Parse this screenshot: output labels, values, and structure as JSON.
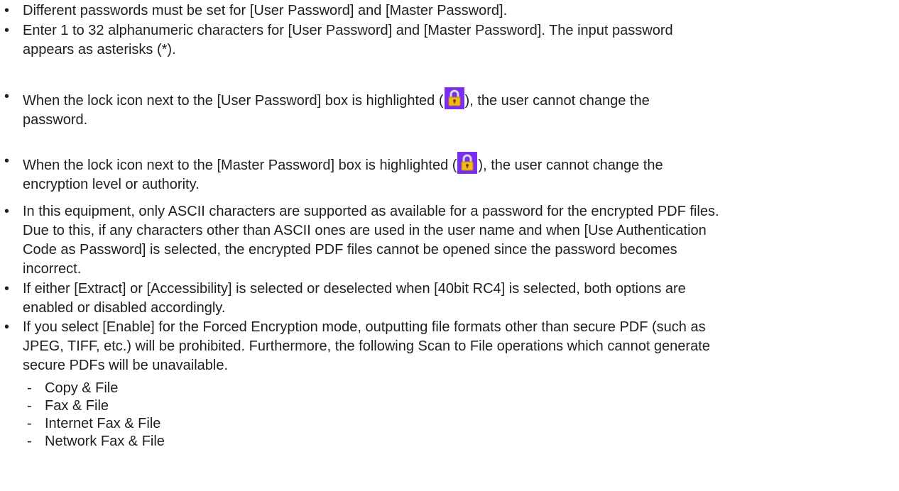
{
  "notes": {
    "b1": "Different passwords must be set for [User Password] and [Master Password].",
    "b2_l1": "Enter 1 to 32 alphanumeric characters for [User Password] and [Master Password]. The input password",
    "b2_l2": "appears as asterisks (*).",
    "b3_pre": "When the lock icon next to the [User Password] box is highlighted (",
    "b3_post": "), the user cannot change the",
    "b3_l2": "password.",
    "b4_pre": "When the lock icon next to the [Master Password] box is highlighted (",
    "b4_post": "), the user cannot change the",
    "b4_l2": "encryption level or authority.",
    "b5_l1": "In this equipment, only ASCII characters are supported as available for a password for the encrypted PDF files.",
    "b5_l2": "Due to this, if any characters other than ASCII ones are used in the user name and when [Use Authentication",
    "b5_l3": "Code as Password] is selected, the encrypted PDF files cannot be opened since the password becomes",
    "b5_l4": "incorrect.",
    "b6_l1": "If either [Extract] or [Accessibility] is selected or deselected when [40bit RC4] is selected, both options are",
    "b6_l2": "enabled or disabled accordingly.",
    "b7_l1": "If you select [Enable] for the Forced Encryption mode, outputting file formats other than secure PDF (such as",
    "b7_l2": "JPEG, TIFF, etc.) will be prohibited. Furthermore, the following Scan to File operations which cannot generate",
    "b7_l3": "secure PDFs will be unavailable.",
    "sub_items": [
      "Copy & File",
      "Fax & File",
      "Internet Fax & File",
      "Network Fax & File"
    ],
    "bullet_char": "•",
    "dash_char": "-"
  },
  "lock_icon": {
    "icon": "padlock-icon",
    "background": "#7a2ff0",
    "body_color": "#f2b81c",
    "shackle_color": "#d9d9d9"
  }
}
